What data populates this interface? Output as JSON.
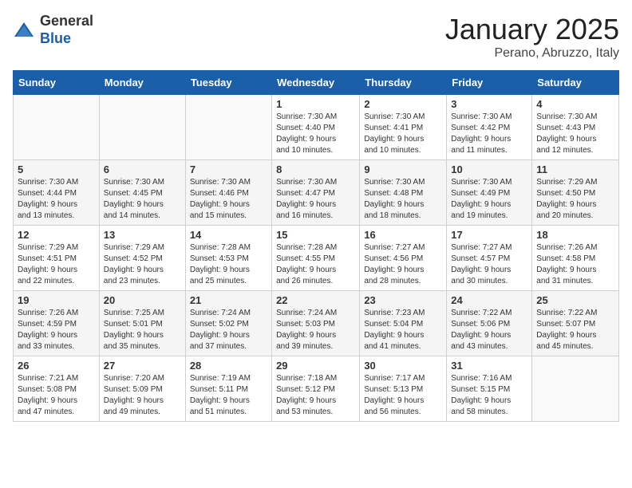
{
  "logo": {
    "general": "General",
    "blue": "Blue"
  },
  "header": {
    "month": "January 2025",
    "location": "Perano, Abruzzo, Italy"
  },
  "weekdays": [
    "Sunday",
    "Monday",
    "Tuesday",
    "Wednesday",
    "Thursday",
    "Friday",
    "Saturday"
  ],
  "weeks": [
    [
      {
        "day": "",
        "info": ""
      },
      {
        "day": "",
        "info": ""
      },
      {
        "day": "",
        "info": ""
      },
      {
        "day": "1",
        "info": "Sunrise: 7:30 AM\nSunset: 4:40 PM\nDaylight: 9 hours\nand 10 minutes."
      },
      {
        "day": "2",
        "info": "Sunrise: 7:30 AM\nSunset: 4:41 PM\nDaylight: 9 hours\nand 10 minutes."
      },
      {
        "day": "3",
        "info": "Sunrise: 7:30 AM\nSunset: 4:42 PM\nDaylight: 9 hours\nand 11 minutes."
      },
      {
        "day": "4",
        "info": "Sunrise: 7:30 AM\nSunset: 4:43 PM\nDaylight: 9 hours\nand 12 minutes."
      }
    ],
    [
      {
        "day": "5",
        "info": "Sunrise: 7:30 AM\nSunset: 4:44 PM\nDaylight: 9 hours\nand 13 minutes."
      },
      {
        "day": "6",
        "info": "Sunrise: 7:30 AM\nSunset: 4:45 PM\nDaylight: 9 hours\nand 14 minutes."
      },
      {
        "day": "7",
        "info": "Sunrise: 7:30 AM\nSunset: 4:46 PM\nDaylight: 9 hours\nand 15 minutes."
      },
      {
        "day": "8",
        "info": "Sunrise: 7:30 AM\nSunset: 4:47 PM\nDaylight: 9 hours\nand 16 minutes."
      },
      {
        "day": "9",
        "info": "Sunrise: 7:30 AM\nSunset: 4:48 PM\nDaylight: 9 hours\nand 18 minutes."
      },
      {
        "day": "10",
        "info": "Sunrise: 7:30 AM\nSunset: 4:49 PM\nDaylight: 9 hours\nand 19 minutes."
      },
      {
        "day": "11",
        "info": "Sunrise: 7:29 AM\nSunset: 4:50 PM\nDaylight: 9 hours\nand 20 minutes."
      }
    ],
    [
      {
        "day": "12",
        "info": "Sunrise: 7:29 AM\nSunset: 4:51 PM\nDaylight: 9 hours\nand 22 minutes."
      },
      {
        "day": "13",
        "info": "Sunrise: 7:29 AM\nSunset: 4:52 PM\nDaylight: 9 hours\nand 23 minutes."
      },
      {
        "day": "14",
        "info": "Sunrise: 7:28 AM\nSunset: 4:53 PM\nDaylight: 9 hours\nand 25 minutes."
      },
      {
        "day": "15",
        "info": "Sunrise: 7:28 AM\nSunset: 4:55 PM\nDaylight: 9 hours\nand 26 minutes."
      },
      {
        "day": "16",
        "info": "Sunrise: 7:27 AM\nSunset: 4:56 PM\nDaylight: 9 hours\nand 28 minutes."
      },
      {
        "day": "17",
        "info": "Sunrise: 7:27 AM\nSunset: 4:57 PM\nDaylight: 9 hours\nand 30 minutes."
      },
      {
        "day": "18",
        "info": "Sunrise: 7:26 AM\nSunset: 4:58 PM\nDaylight: 9 hours\nand 31 minutes."
      }
    ],
    [
      {
        "day": "19",
        "info": "Sunrise: 7:26 AM\nSunset: 4:59 PM\nDaylight: 9 hours\nand 33 minutes."
      },
      {
        "day": "20",
        "info": "Sunrise: 7:25 AM\nSunset: 5:01 PM\nDaylight: 9 hours\nand 35 minutes."
      },
      {
        "day": "21",
        "info": "Sunrise: 7:24 AM\nSunset: 5:02 PM\nDaylight: 9 hours\nand 37 minutes."
      },
      {
        "day": "22",
        "info": "Sunrise: 7:24 AM\nSunset: 5:03 PM\nDaylight: 9 hours\nand 39 minutes."
      },
      {
        "day": "23",
        "info": "Sunrise: 7:23 AM\nSunset: 5:04 PM\nDaylight: 9 hours\nand 41 minutes."
      },
      {
        "day": "24",
        "info": "Sunrise: 7:22 AM\nSunset: 5:06 PM\nDaylight: 9 hours\nand 43 minutes."
      },
      {
        "day": "25",
        "info": "Sunrise: 7:22 AM\nSunset: 5:07 PM\nDaylight: 9 hours\nand 45 minutes."
      }
    ],
    [
      {
        "day": "26",
        "info": "Sunrise: 7:21 AM\nSunset: 5:08 PM\nDaylight: 9 hours\nand 47 minutes."
      },
      {
        "day": "27",
        "info": "Sunrise: 7:20 AM\nSunset: 5:09 PM\nDaylight: 9 hours\nand 49 minutes."
      },
      {
        "day": "28",
        "info": "Sunrise: 7:19 AM\nSunset: 5:11 PM\nDaylight: 9 hours\nand 51 minutes."
      },
      {
        "day": "29",
        "info": "Sunrise: 7:18 AM\nSunset: 5:12 PM\nDaylight: 9 hours\nand 53 minutes."
      },
      {
        "day": "30",
        "info": "Sunrise: 7:17 AM\nSunset: 5:13 PM\nDaylight: 9 hours\nand 56 minutes."
      },
      {
        "day": "31",
        "info": "Sunrise: 7:16 AM\nSunset: 5:15 PM\nDaylight: 9 hours\nand 58 minutes."
      },
      {
        "day": "",
        "info": ""
      }
    ]
  ]
}
